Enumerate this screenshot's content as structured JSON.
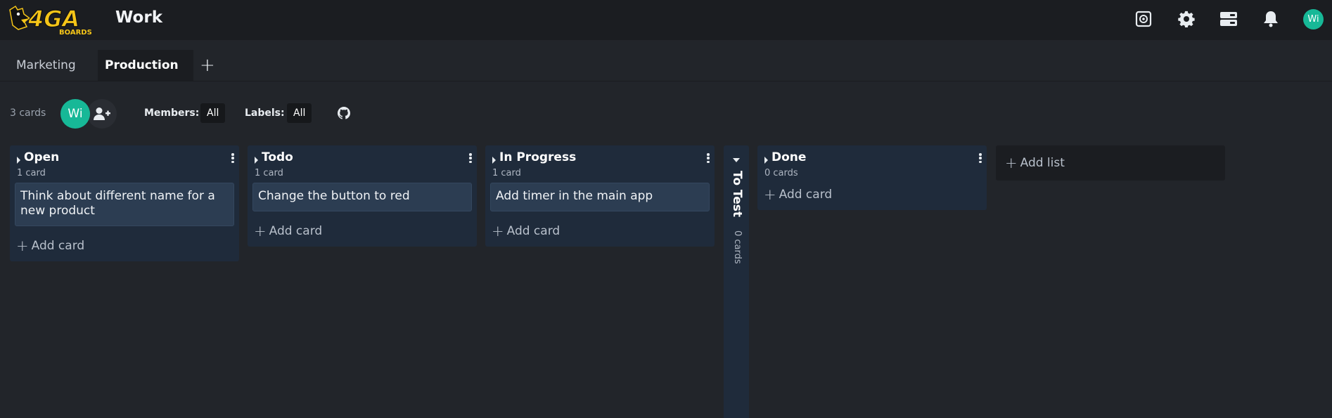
{
  "header": {
    "logo_text": "4GA",
    "logo_subtext": "BOARDS",
    "project_title": "Work",
    "icons": [
      "screenshot-icon",
      "gear-icon",
      "server-icon",
      "bell-icon"
    ],
    "user_initials": "Wi"
  },
  "tabs": [
    {
      "label": "Marketing",
      "active": false
    },
    {
      "label": "Production",
      "active": true
    }
  ],
  "tab_add_label": "+",
  "filters": {
    "cards_count": "3 cards",
    "member_initials": "Wi",
    "members_label": "Members:",
    "members_value": "All",
    "labels_label": "Labels:",
    "labels_value": "All"
  },
  "lists": [
    {
      "name": "Open",
      "count": "1 card",
      "cards": [
        "Think about different name for a new product"
      ],
      "add_card": "Add card"
    },
    {
      "name": "Todo",
      "count": "1 card",
      "cards": [
        "Change the button to red"
      ],
      "add_card": "Add card"
    },
    {
      "name": "In Progress",
      "count": "1 card",
      "cards": [
        "Add timer in the main app"
      ],
      "add_card": "Add card"
    },
    {
      "name": "Done",
      "count": "0 cards",
      "cards": [],
      "add_card": "Add card"
    }
  ],
  "collapsed_list": {
    "name": "To Test",
    "count": "0 cards"
  },
  "add_list_label": "Add list",
  "colors": {
    "background": "#22252a",
    "header": "#1b1d21",
    "list": "#1f2b3b",
    "card": "#2c3d52",
    "avatar": "#17b897",
    "logo_yellow": "#f5c518"
  }
}
